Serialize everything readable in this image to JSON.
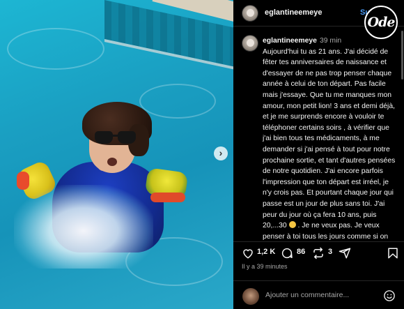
{
  "post": {
    "username": "eglantineemeye",
    "follow_label": "Suivre",
    "badge_text": "Ode",
    "carousel_next": "›"
  },
  "caption": {
    "username": "eglantineemeye",
    "time": "39 min",
    "text_before_emoji": "Aujourd'hui tu as 21 ans. J'ai décidé de fêter tes anniversaires de naissance et d'essayer de ne pas trop penser chaque année à celui de ton départ. Pas facile mais j'essaye. Que tu me manques mon amour, mon petit lion! 3 ans et demi déjà, et je me surprends encore à vouloir te téléphoner certains soirs , à vérifier que j'ai bien tous tes médicaments, à me demander si j'ai pensé à tout pour notre prochaine sortie, et tant d'autres pensées de notre quotidien. J'ai encore parfois l'impression que ton départ est irréel, je n'y crois pas. Et pourtant chaque jour qui passe est un jour de plus sans toi. J'ai peur du jour où ça fera 10 ans, puis 20,...30",
    "text_after_emoji": ". Je ne veux pas. Je veux penser à toi tous les jours comme si on allait se retrouver demain. Je veux que le"
  },
  "actions": {
    "likes": "1,2 K",
    "comments": "86",
    "reposts": "3"
  },
  "timestamp": "Il y a 39 minutes",
  "comment_box": {
    "placeholder": "Ajouter un commentaire..."
  },
  "icons": [
    "heart-icon",
    "comment-icon",
    "repost-icon",
    "share-icon",
    "save-icon",
    "emoji-icon",
    "chevron-right-icon"
  ]
}
